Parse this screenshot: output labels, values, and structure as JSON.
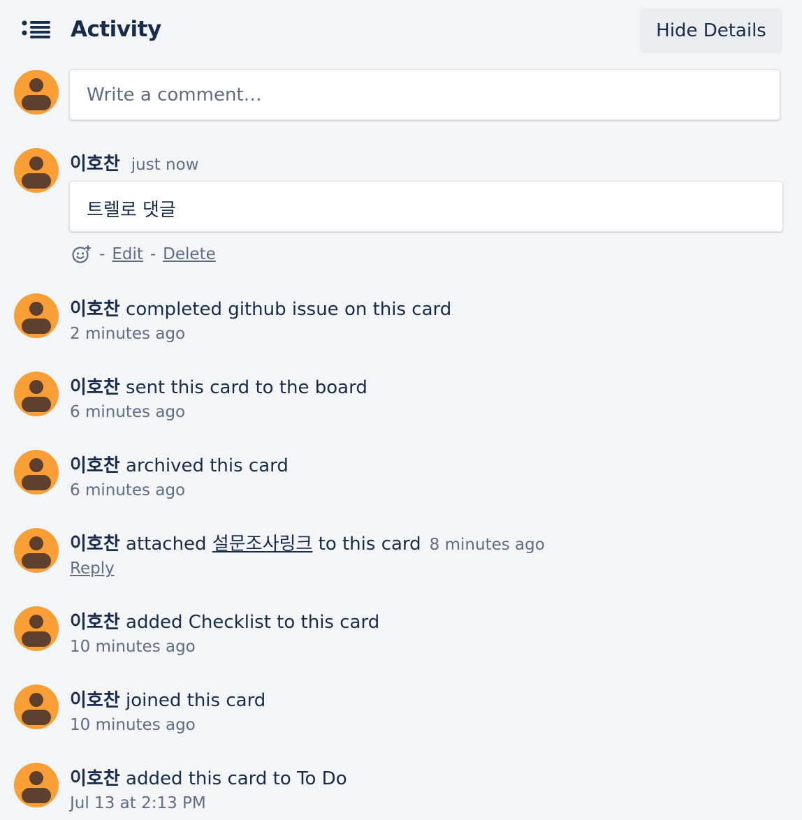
{
  "header": {
    "icon": "activity-list-icon",
    "title": "Activity",
    "hide_details_label": "Hide Details"
  },
  "comment_composer": {
    "placeholder": "Write a comment…"
  },
  "comment": {
    "author": "이호찬",
    "time": "just now",
    "text": "트렐로 댓글",
    "reaction_icon": "add-reaction-icon",
    "separator": "-",
    "edit_label": "Edit",
    "delete_label": "Delete"
  },
  "activities": [
    {
      "author": "이호찬",
      "action": " completed github issue on this card",
      "time": "2 minutes ago"
    },
    {
      "author": "이호찬",
      "action": " sent this card to the board",
      "time": "6 minutes ago"
    },
    {
      "author": "이호찬",
      "action": " archived this card",
      "time": "6 minutes ago"
    },
    {
      "author": "이호찬",
      "action_before": " attached ",
      "link_text": "설문조사링크",
      "action_after": " to this card",
      "time": "8 minutes ago",
      "reply_label": "Reply"
    },
    {
      "author": "이호찬",
      "action": " added Checklist to this card",
      "time": "10 minutes ago"
    },
    {
      "author": "이호찬",
      "action": " joined this card",
      "time": "10 minutes ago"
    },
    {
      "author": "이호찬",
      "action": " added this card to To Do",
      "time": "Jul 13 at 2:13 PM"
    }
  ],
  "colors": {
    "background": "#f4f5f7",
    "text": "#172b4d",
    "muted": "#5e6c84",
    "avatar": "#f99f35",
    "avatar_figure": "#5c3f2d"
  }
}
